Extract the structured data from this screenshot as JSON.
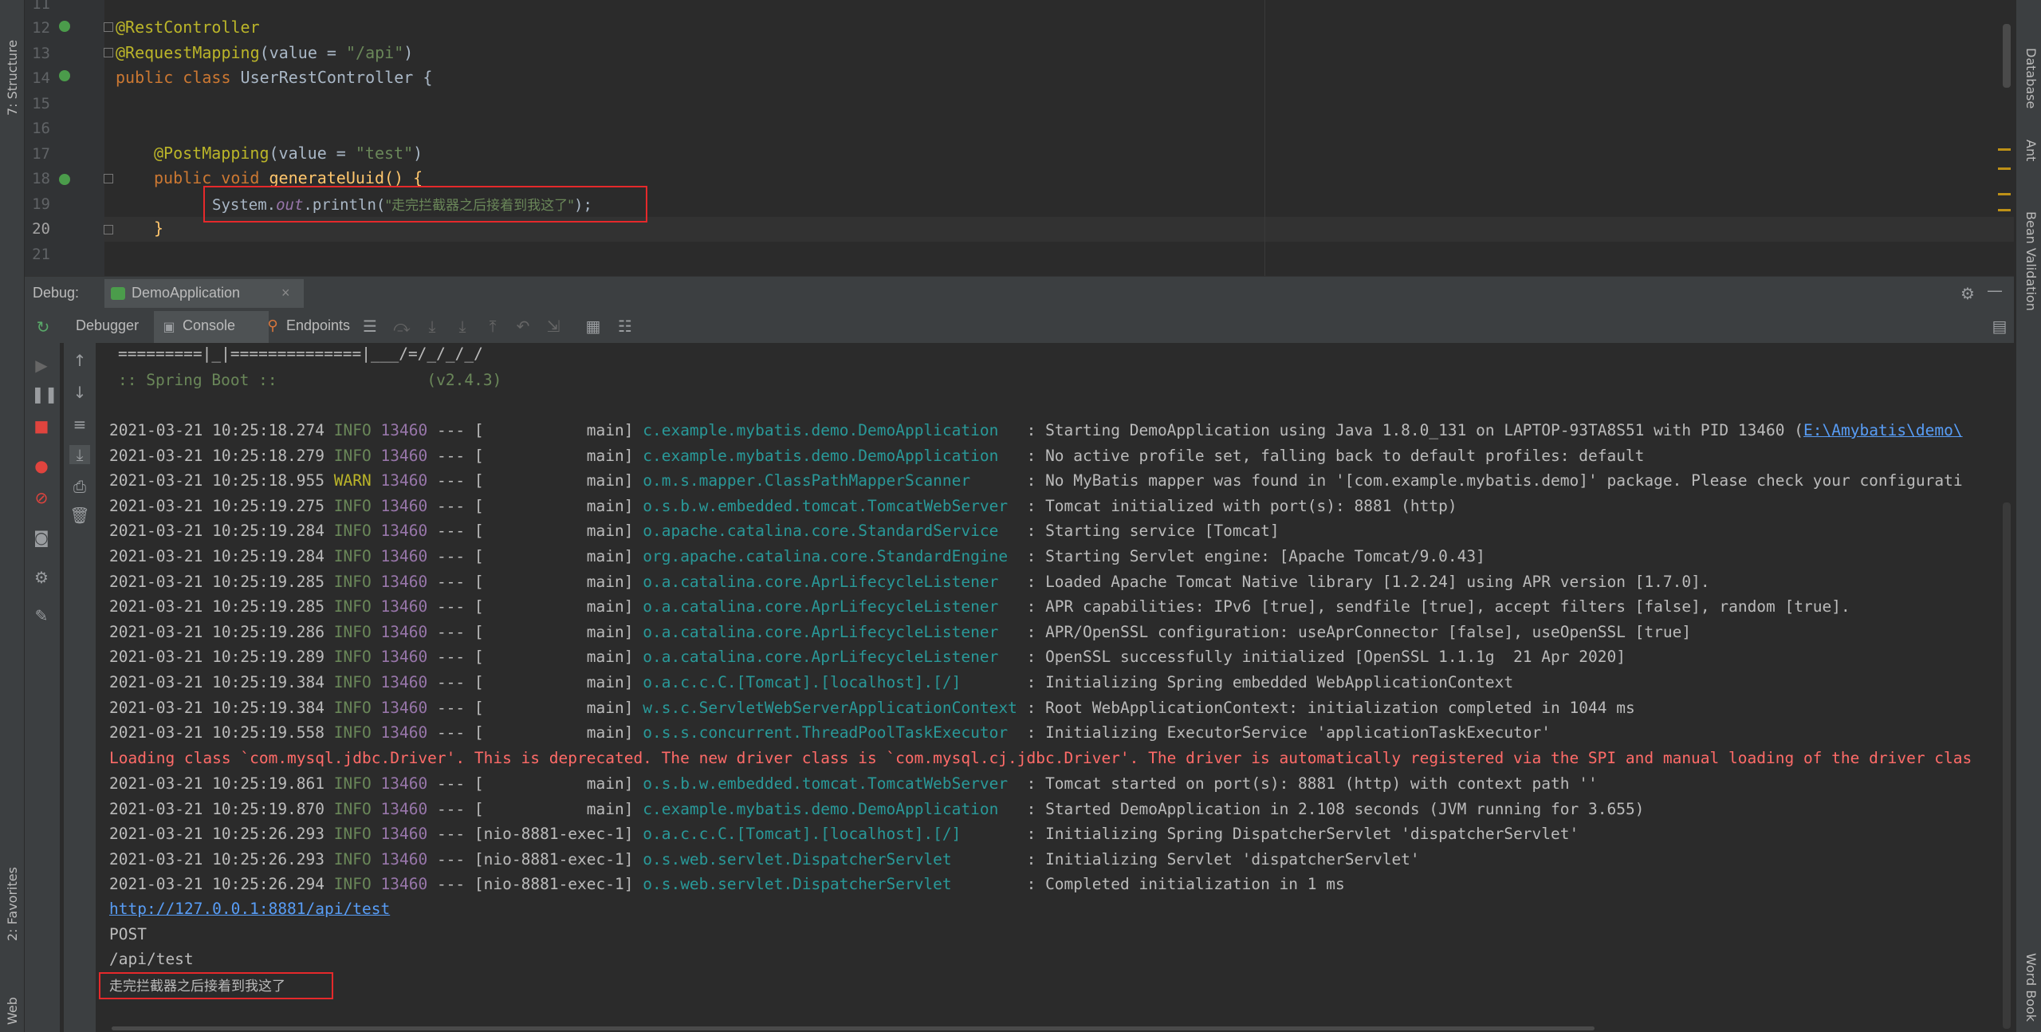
{
  "editor": {
    "line_numbers": [
      "11",
      "12",
      "13",
      "14",
      "15",
      "16",
      "17",
      "18",
      "19",
      "20",
      "21"
    ],
    "lines": {
      "l12": "@RestController",
      "l13_a": "@RequestMapping",
      "l13_b": "(value = ",
      "l13_c": "\"/api\"",
      "l13_d": ")",
      "l14_a": "public class ",
      "l14_b": "UserRestController {",
      "l17_a": "@PostMapping",
      "l17_b": "(value = ",
      "l17_c": "\"test\"",
      "l17_d": ")",
      "l18_a": "public void ",
      "l18_b": "generateUuid() {",
      "l19_a": "System.",
      "l19_b": "out",
      "l19_c": ".println(",
      "l19_d": "\"走完拦截器之后接着到我这了\"",
      "l19_e": ");",
      "l20": "}"
    }
  },
  "left_strip": {
    "structure": "7: Structure",
    "favorites": "2: Favorites",
    "web": "Web"
  },
  "right_strip": {
    "database": "Database",
    "ant": "Ant",
    "bean_validation": "Bean Validation",
    "word_book": "Word Book"
  },
  "debug": {
    "label": "Debug:",
    "run_config": "DemoApplication",
    "tabs": {
      "debugger": "Debugger",
      "console": "Console",
      "endpoints": "Endpoints"
    }
  },
  "console": {
    "banner1": "=========|_|==============|___/=/_/_/_/",
    "banner2": ":: Spring Boot ::                (v2.4.3)",
    "logs": [
      {
        "ts": "2021-03-21 10:25:18.274",
        "lvl": "INFO",
        "pid": "13460",
        "mid": " --- [           main] ",
        "logger": "c.example.mybatis.demo.DemoApplication  ",
        "msg": " : Starting DemoApplication using Java 1.8.0_131 on LAPTOP-93TA8S51 with PID 13460 (",
        "link": "E:\\Amybatis\\demo\\"
      },
      {
        "ts": "2021-03-21 10:25:18.279",
        "lvl": "INFO",
        "pid": "13460",
        "mid": " --- [           main] ",
        "logger": "c.example.mybatis.demo.DemoApplication  ",
        "msg": " : No active profile set, falling back to default profiles: default",
        "link": ""
      },
      {
        "ts": "2021-03-21 10:25:18.955",
        "lvl": "WARN",
        "pid": "13460",
        "mid": " --- [           main] ",
        "logger": "o.m.s.mapper.ClassPathMapperScanner     ",
        "msg": " : No MyBatis mapper was found in '[com.example.mybatis.demo]' package. Please check your configurati",
        "link": ""
      },
      {
        "ts": "2021-03-21 10:25:19.275",
        "lvl": "INFO",
        "pid": "13460",
        "mid": " --- [           main] ",
        "logger": "o.s.b.w.embedded.tomcat.TomcatWebServer ",
        "msg": " : Tomcat initialized with port(s): 8881 (http)",
        "link": ""
      },
      {
        "ts": "2021-03-21 10:25:19.284",
        "lvl": "INFO",
        "pid": "13460",
        "mid": " --- [           main] ",
        "logger": "o.apache.catalina.core.StandardService  ",
        "msg": " : Starting service [Tomcat]",
        "link": ""
      },
      {
        "ts": "2021-03-21 10:25:19.284",
        "lvl": "INFO",
        "pid": "13460",
        "mid": " --- [           main] ",
        "logger": "org.apache.catalina.core.StandardEngine ",
        "msg": " : Starting Servlet engine: [Apache Tomcat/9.0.43]",
        "link": ""
      },
      {
        "ts": "2021-03-21 10:25:19.285",
        "lvl": "INFO",
        "pid": "13460",
        "mid": " --- [           main] ",
        "logger": "o.a.catalina.core.AprLifecycleListener  ",
        "msg": " : Loaded Apache Tomcat Native library [1.2.24] using APR version [1.7.0].",
        "link": ""
      },
      {
        "ts": "2021-03-21 10:25:19.285",
        "lvl": "INFO",
        "pid": "13460",
        "mid": " --- [           main] ",
        "logger": "o.a.catalina.core.AprLifecycleListener  ",
        "msg": " : APR capabilities: IPv6 [true], sendfile [true], accept filters [false], random [true].",
        "link": ""
      },
      {
        "ts": "2021-03-21 10:25:19.286",
        "lvl": "INFO",
        "pid": "13460",
        "mid": " --- [           main] ",
        "logger": "o.a.catalina.core.AprLifecycleListener  ",
        "msg": " : APR/OpenSSL configuration: useAprConnector [false], useOpenSSL [true]",
        "link": ""
      },
      {
        "ts": "2021-03-21 10:25:19.289",
        "lvl": "INFO",
        "pid": "13460",
        "mid": " --- [           main] ",
        "logger": "o.a.catalina.core.AprLifecycleListener  ",
        "msg": " : OpenSSL successfully initialized [OpenSSL 1.1.1g  21 Apr 2020]",
        "link": ""
      },
      {
        "ts": "2021-03-21 10:25:19.384",
        "lvl": "INFO",
        "pid": "13460",
        "mid": " --- [           main] ",
        "logger": "o.a.c.c.C.[Tomcat].[localhost].[/]      ",
        "msg": " : Initializing Spring embedded WebApplicationContext",
        "link": ""
      },
      {
        "ts": "2021-03-21 10:25:19.384",
        "lvl": "INFO",
        "pid": "13460",
        "mid": " --- [           main] ",
        "logger": "w.s.c.ServletWebServerApplicationContext",
        "msg": " : Root WebApplicationContext: initialization completed in 1044 ms",
        "link": ""
      },
      {
        "ts": "2021-03-21 10:25:19.558",
        "lvl": "INFO",
        "pid": "13460",
        "mid": " --- [           main] ",
        "logger": "o.s.s.concurrent.ThreadPoolTaskExecutor ",
        "msg": " : Initializing ExecutorService 'applicationTaskExecutor'",
        "link": ""
      }
    ],
    "error_line": "Loading class `com.mysql.jdbc.Driver'. This is deprecated. The new driver class is `com.mysql.cj.jdbc.Driver'. The driver is automatically registered via the SPI and manual loading of the driver clas",
    "logs2": [
      {
        "ts": "2021-03-21 10:25:19.861",
        "lvl": "INFO",
        "pid": "13460",
        "mid": " --- [           main] ",
        "logger": "o.s.b.w.embedded.tomcat.TomcatWebServer ",
        "msg": " : Tomcat started on port(s): 8881 (http) with context path ''",
        "link": ""
      },
      {
        "ts": "2021-03-21 10:25:19.870",
        "lvl": "INFO",
        "pid": "13460",
        "mid": " --- [           main] ",
        "logger": "c.example.mybatis.demo.DemoApplication  ",
        "msg": " : Started DemoApplication in 2.108 seconds (JVM running for 3.655)",
        "link": ""
      },
      {
        "ts": "2021-03-21 10:25:26.293",
        "lvl": "INFO",
        "pid": "13460",
        "mid": " --- [nio-8881-exec-1] ",
        "logger": "o.a.c.c.C.[Tomcat].[localhost].[/]      ",
        "msg": " : Initializing Spring DispatcherServlet 'dispatcherServlet'",
        "link": ""
      },
      {
        "ts": "2021-03-21 10:25:26.293",
        "lvl": "INFO",
        "pid": "13460",
        "mid": " --- [nio-8881-exec-1] ",
        "logger": "o.s.web.servlet.DispatcherServlet       ",
        "msg": " : Initializing Servlet 'dispatcherServlet'",
        "link": ""
      },
      {
        "ts": "2021-03-21 10:25:26.294",
        "lvl": "INFO",
        "pid": "13460",
        "mid": " --- [nio-8881-exec-1] ",
        "logger": "o.s.web.servlet.DispatcherServlet       ",
        "msg": " : Completed initialization in 1 ms",
        "link": ""
      }
    ],
    "url": "http://127.0.0.1:8881/api/test",
    "method": "POST",
    "path": "/api/test",
    "output": "走完拦截器之后接着到我这了"
  },
  "colors": {
    "background": "#2b2b2b",
    "panel": "#3c3f41",
    "highlight_box": "#e5292b",
    "info": "#6a8759",
    "warn": "#bbb529",
    "logger": "#299999",
    "error": "#ff6b68",
    "link": "#589df6"
  },
  "icons": [
    "rerun-icon",
    "resume-icon",
    "pause-icon",
    "stop-icon",
    "view-breakpoints-icon",
    "mute-breakpoints-icon",
    "camera-icon",
    "settings-icon",
    "pin-icon",
    "up-arrow-icon",
    "down-arrow-icon",
    "soft-wrap-icon",
    "scroll-to-end-icon",
    "print-icon",
    "trash-icon",
    "gear-icon",
    "minimize-icon",
    "layout-icon"
  ]
}
